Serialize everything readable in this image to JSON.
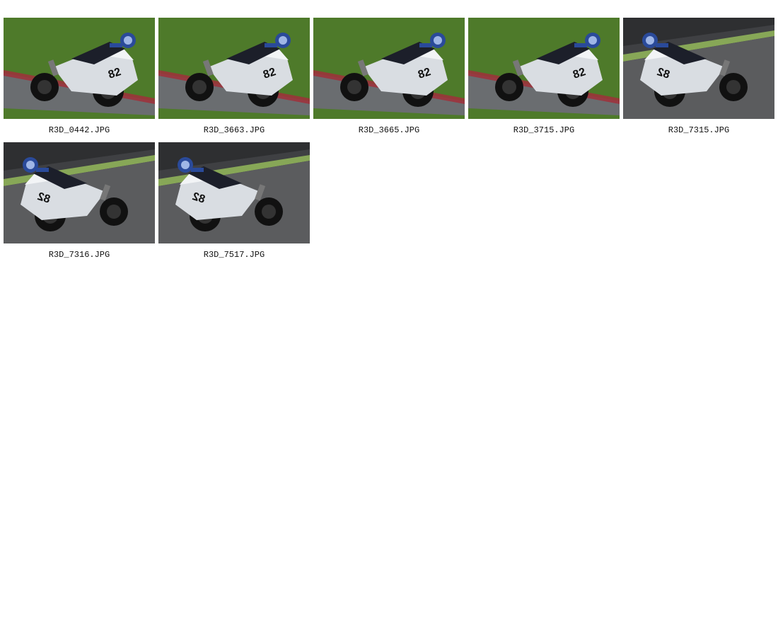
{
  "gallery": {
    "items": [
      {
        "filename": "R3D_0442.JPG",
        "background": "green-grass",
        "bike_number": "82",
        "lean": "left"
      },
      {
        "filename": "R3D_3663.JPG",
        "background": "green-grass",
        "bike_number": "82",
        "lean": "left"
      },
      {
        "filename": "R3D_3665.JPG",
        "background": "green-grass",
        "bike_number": "82",
        "lean": "left"
      },
      {
        "filename": "R3D_3715.JPG",
        "background": "green-grass",
        "bike_number": "82",
        "lean": "left"
      },
      {
        "filename": "R3D_7315.JPG",
        "background": "asphalt",
        "bike_number": "82",
        "lean": "right"
      },
      {
        "filename": "R3D_7316.JPG",
        "background": "asphalt",
        "bike_number": "82",
        "lean": "right"
      },
      {
        "filename": "R3D_7517.JPG",
        "background": "asphalt",
        "bike_number": "82",
        "lean": "right"
      }
    ]
  },
  "colors": {
    "page_background": "#ffffff",
    "grass": "#4e7a2a",
    "asphalt": "#5b5c5e",
    "kerb_red": "#a0303a",
    "fairing": "#d9dde2",
    "rider_blue": "#2a4a9a"
  }
}
